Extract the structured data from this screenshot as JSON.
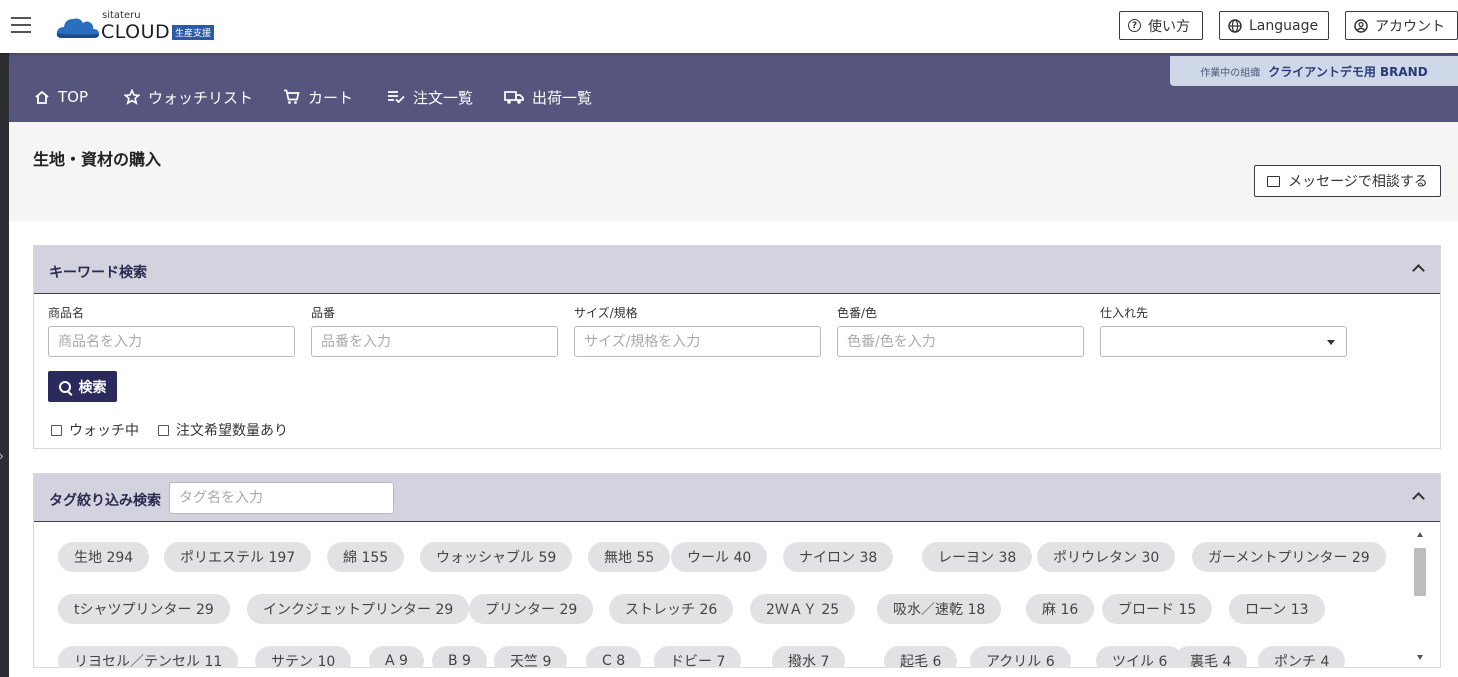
{
  "header": {
    "logo_sub": "sitateru",
    "logo_word": "CLOUD",
    "logo_badge": "生産支援",
    "help_label": "使い方",
    "language_label": "Language",
    "account_label": "アカウント"
  },
  "nav": {
    "items": [
      {
        "label": "TOP",
        "icon": "home-icon"
      },
      {
        "label": "ウォッチリスト",
        "icon": "star-icon"
      },
      {
        "label": "カート",
        "icon": "cart-icon"
      },
      {
        "label": "注文一覧",
        "icon": "list-check-icon"
      },
      {
        "label": "出荷一覧",
        "icon": "truck-icon"
      }
    ],
    "org_label": "作業中の組織",
    "org_value": "クライアントデモ用 BRAND"
  },
  "page": {
    "title": "生地・資材の購入",
    "message_button": "メッセージで相談する"
  },
  "keyword_search": {
    "title": "キーワード検索",
    "fields": [
      {
        "label": "商品名",
        "placeholder": "商品名を入力"
      },
      {
        "label": "品番",
        "placeholder": "品番を入力"
      },
      {
        "label": "サイズ/規格",
        "placeholder": "サイズ/規格を入力"
      },
      {
        "label": "色番/色",
        "placeholder": "色番/色を入力"
      }
    ],
    "supplier_label": "仕入れ先",
    "search_button": "検索",
    "checkboxes": [
      "ウォッチ中",
      "注文希望数量あり"
    ]
  },
  "tag_search": {
    "title": "タグ絞り込み検索",
    "placeholder": "タグ名を入力",
    "tags": [
      [
        "生地 294",
        "ポリエステル 197",
        "綿 155",
        "ウォッシャブル 59",
        "無地 55",
        "ウール 40",
        "ナイロン 38",
        "レーヨン 38",
        "ポリウレタン 30",
        "ガーメントプリンター 29"
      ],
      [
        "tシャツプリンター 29",
        "インクジェットプリンター 29",
        "プリンター 29",
        "ストレッチ 26",
        "2ＷＡＹ 25",
        "吸水／速乾 18",
        "麻 16",
        "ブロード 15",
        "ローン 13"
      ],
      [
        "リヨセル／テンセル 11",
        "サテン 10",
        "A 9",
        "B 9",
        "天竺 9",
        "C 8",
        "ドビー 7",
        "撥水 7",
        "起毛 6",
        "アクリル 6",
        "ツイル 6",
        "裏毛 4",
        "ポンチ 4"
      ]
    ]
  }
}
